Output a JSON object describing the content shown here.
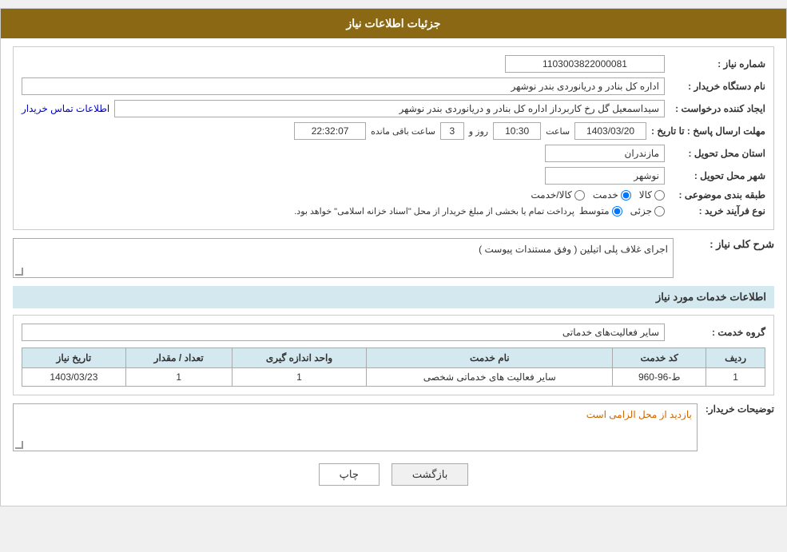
{
  "header": {
    "title": "جزئیات اطلاعات نیاز"
  },
  "fields": {
    "request_number_label": "شماره نیاز :",
    "request_number_value": "1103003822000081",
    "buyer_org_label": "نام دستگاه خریدار :",
    "buyer_org_value": "اداره کل بنادر و دریانوردی بندر نوشهر",
    "creator_label": "ایجاد کننده درخواست :",
    "creator_value": "سیداسمعیل گل رخ کاربرداز اداره کل بنادر و دریانوردی بندر نوشهر",
    "contact_info_link": "اطلاعات تماس خریدار",
    "response_deadline_label": "مهلت ارسال پاسخ : تا تاریخ :",
    "response_date": "1403/03/20",
    "response_time_label": "ساعت",
    "response_time": "10:30",
    "response_days_label": "روز و",
    "response_days": "3",
    "response_remaining_label": "ساعت باقی مانده",
    "response_remaining": "22:32:07",
    "province_label": "استان محل تحویل :",
    "province_value": "مازندران",
    "city_label": "شهر محل تحویل :",
    "city_value": "نوشهر",
    "category_label": "طبقه بندی موضوعی :",
    "category_options": [
      {
        "label": "کالا",
        "value": "kala"
      },
      {
        "label": "خدمت",
        "value": "khedmat"
      },
      {
        "label": "کالا/خدمت",
        "value": "kala_khedmat"
      }
    ],
    "category_selected": "khedmat",
    "purchase_type_label": "نوع فرآیند خرید :",
    "purchase_type_options": [
      {
        "label": "جزئی",
        "value": "jozi"
      },
      {
        "label": "متوسط",
        "value": "motavaset"
      }
    ],
    "purchase_type_selected": "motavaset",
    "purchase_note": "پرداخت تمام یا بخشی از مبلغ خریدار از محل \"اسناد خزانه اسلامی\" خواهد بود.",
    "general_desc_label": "شرح کلی نیاز :",
    "general_desc_value": "اجرای غلاف پلی اتیلین ( وفق مستندات پیوست )",
    "services_section_title": "اطلاعات خدمات مورد نیاز",
    "service_group_label": "گروه خدمت :",
    "service_group_value": "سایر فعالیت‌های خدماتی",
    "table": {
      "columns": [
        {
          "label": "ردیف",
          "key": "row"
        },
        {
          "label": "کد خدمت",
          "key": "service_code"
        },
        {
          "label": "نام خدمت",
          "key": "service_name"
        },
        {
          "label": "واحد اندازه گیری",
          "key": "unit"
        },
        {
          "label": "تعداد / مقدار",
          "key": "quantity"
        },
        {
          "label": "تاریخ نیاز",
          "key": "date"
        }
      ],
      "rows": [
        {
          "row": "1",
          "service_code": "ط-96-960",
          "service_name": "سایر فعالیت های خدماتی شخصی",
          "unit": "1",
          "quantity": "1",
          "date": "1403/03/23"
        }
      ]
    },
    "buyer_notes_label": "توضیحات خریدار:",
    "buyer_notes_value": "بازدید از محل الزامی است"
  },
  "buttons": {
    "print_label": "چاپ",
    "back_label": "بازگشت"
  }
}
